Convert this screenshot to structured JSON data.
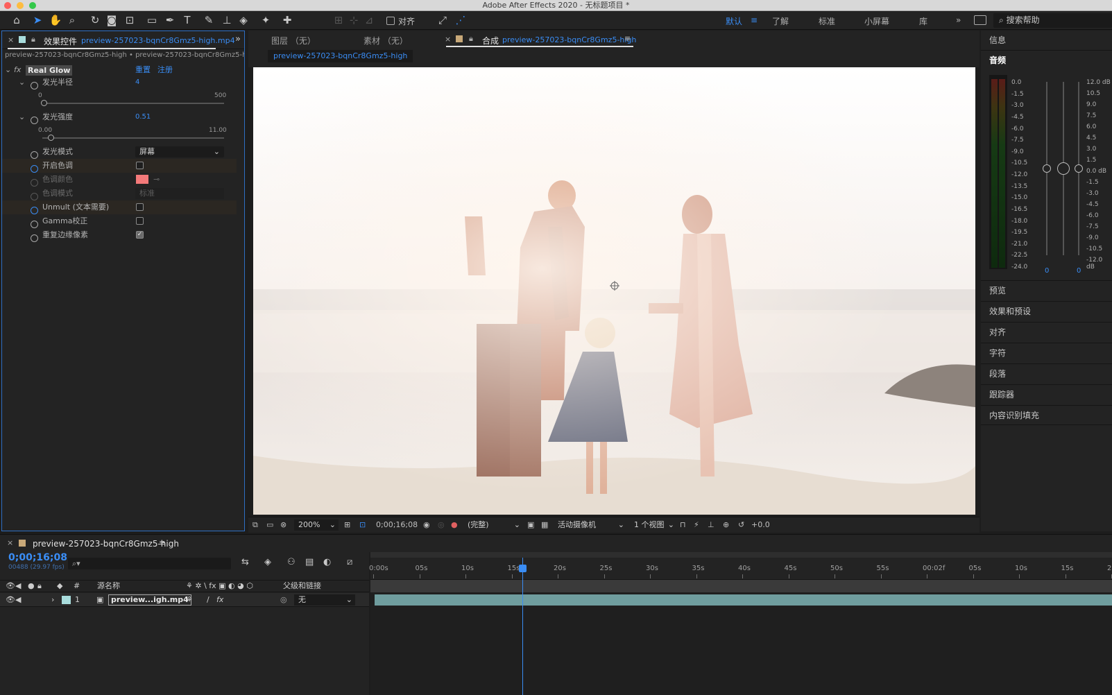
{
  "window": {
    "title": "Adobe After Effects 2020 - 无标题项目 *"
  },
  "workspaces": {
    "items": [
      "默认",
      "了解",
      "标准",
      "小屏幕",
      "库"
    ],
    "search_label": "搜索帮助",
    "align_label": "对齐"
  },
  "effect_controls": {
    "tab_title": "效果控件",
    "tab_file": "preview-257023-bqnCr8Gmz5-high.mp4",
    "breadcrumb": "preview-257023-bqnCr8Gmz5-high • preview-257023-bqnCr8Gmz5-high.mp4",
    "effect_name": "Real Glow",
    "reset_label": "重置",
    "register_label": "注册",
    "radius": {
      "label": "发光半径",
      "value": "4",
      "min": "0",
      "max": "500",
      "fraction": 0.008
    },
    "intensity": {
      "label": "发光强度",
      "value": "0.51",
      "min": "0.00",
      "max": "11.00",
      "fraction": 0.046
    },
    "blend_mode": {
      "label": "发光模式",
      "value": "屏幕"
    },
    "enable_tint": {
      "label": "开启色调"
    },
    "tint_color": {
      "label": "色调颜色",
      "color": "#f47a7a"
    },
    "tint_mode": {
      "label": "色调模式",
      "value": "标准"
    },
    "unmult": {
      "label": "Unmult (文本需要)"
    },
    "gamma": {
      "label": "Gamma校正"
    },
    "repeat_edge": {
      "label": "重复边缘像素"
    }
  },
  "viewer": {
    "layer_tab": "图层 （无）",
    "footage_tab": "素材 （无）",
    "comp_tab_label": "合成",
    "comp_tab_name": "preview-257023-bqnCr8Gmz5-high",
    "subtab": "preview-257023-bqnCr8Gmz5-high",
    "zoom": "200%",
    "timecode": "0;00;16;08",
    "quality": "(完整)",
    "camera": "活动摄像机",
    "views": "1 个视图",
    "exposure": "+0.0"
  },
  "right_panel": {
    "info_label": "信息",
    "audio_label": "音频",
    "db_left": [
      "0.0",
      "-1.5",
      "-3.0",
      "-4.5",
      "-6.0",
      "-7.5",
      "-9.0",
      "-10.5",
      "-12.0",
      "-13.5",
      "-15.0",
      "-16.5",
      "-18.0",
      "-19.5",
      "-21.0",
      "-22.5",
      "-24.0"
    ],
    "db_right": [
      "12.0 dB",
      "10.5",
      "9.0",
      "7.5",
      "6.0",
      "4.5",
      "3.0",
      "1.5",
      "0.0 dB",
      "-1.5",
      "-3.0",
      "-4.5",
      "-6.0",
      "-7.5",
      "-9.0",
      "-10.5",
      "-12.0 dB"
    ],
    "left_value": "0",
    "right_value": "0",
    "panels": [
      "预览",
      "效果和预设",
      "对齐",
      "字符",
      "段落",
      "跟踪器",
      "内容识别填充"
    ]
  },
  "timeline": {
    "comp_name": "preview-257023-bqnCr8Gmz5-high",
    "timecode": "0;00;16;08",
    "frames": "00488 (29.97 fps)",
    "col_source": "源名称",
    "col_parent": "父级和链接",
    "layer_index": "1",
    "layer_name": "preview...igh.mp4",
    "parent_value": "无",
    "ruler": [
      "0:00s",
      "05s",
      "10s",
      "15s",
      "20s",
      "25s",
      "30s",
      "35s",
      "40s",
      "45s",
      "50s",
      "55s",
      "00:02f",
      "05s",
      "10s",
      "15s",
      "2"
    ],
    "playhead_fraction": 0.205
  }
}
